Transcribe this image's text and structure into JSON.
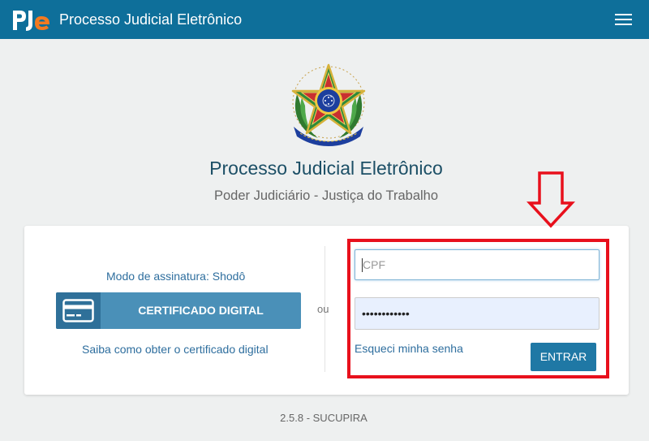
{
  "header": {
    "logo_text": "PJe",
    "app_title": "Processo Judicial Eletrônico",
    "menu_icon": "hamburger-menu-icon",
    "background_color": "#0e6f9a"
  },
  "hero": {
    "emblem_icon": "brazil-coat-of-arms-icon",
    "title": "Processo Judicial Eletrônico",
    "subtitle": "Poder Judiciário - Justiça do Trabalho"
  },
  "login_card": {
    "sign_mode_label": "Modo de assinatura: Shodô",
    "certificate_button_label": "CERTIFICADO DIGITAL",
    "certificate_icon": "credit-card-icon",
    "certificate_link": "Saiba como obter o certificado digital",
    "or_label": "ou",
    "cpf_placeholder": "CPF",
    "cpf_value": "",
    "password_value": "••••••••••••",
    "forgot_password_link": "Esqueci minha senha",
    "submit_label": "ENTRAR"
  },
  "annotation": {
    "highlight_color": "#e8101c",
    "arrow_icon": "down-arrow-icon"
  },
  "footer": {
    "version": "2.5.8 - SUCUPIRA"
  }
}
